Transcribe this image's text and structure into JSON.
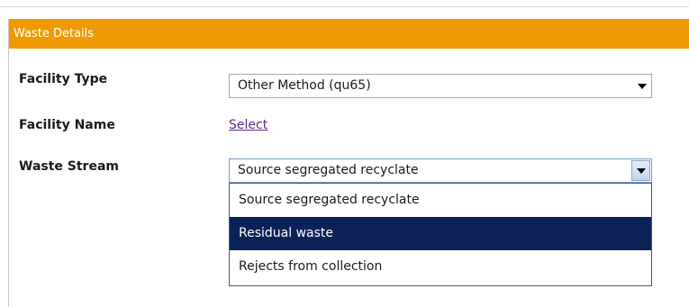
{
  "panel": {
    "title": "Waste Details"
  },
  "form": {
    "facility_type": {
      "label": "Facility Type",
      "value": "Other Method (qu65)"
    },
    "facility_name": {
      "label": "Facility Name",
      "link": "Select"
    },
    "waste_stream": {
      "label": "Waste Stream",
      "value": "Source segregated recyclate",
      "options": [
        "Source segregated recyclate",
        "Residual waste",
        "Rejects from collection"
      ],
      "highlighted_option": "Residual waste"
    }
  },
  "colors": {
    "header": "#ee9a00",
    "highlight": "#0a2258",
    "link": "#5a2e8a"
  }
}
